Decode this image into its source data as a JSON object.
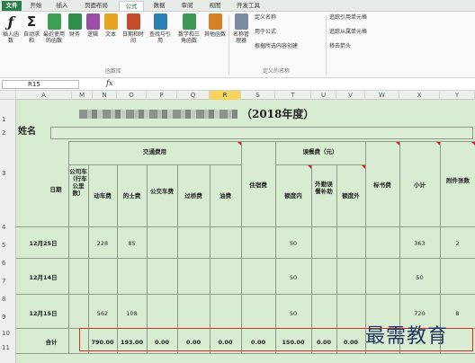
{
  "tabs": [
    "文件",
    "开始",
    "插入",
    "页面布局",
    "公式",
    "数据",
    "审阅",
    "视图",
    "开发工具"
  ],
  "ribbon": {
    "insert_function": "插入函数",
    "autosum": "自动求和",
    "recent": "最近使用的函数",
    "finance": "财务",
    "logical": "逻辑",
    "text": "文本",
    "datetime": "日期和时间",
    "lookup": "查找与引用",
    "math": "数学和三角函数",
    "more": "其他函数",
    "function_library": "函数库",
    "name_manager": "名称管理器",
    "define_name": "定义名称",
    "use_in_formula": "用于公式",
    "create_from_selection": "根据所选内容创建",
    "defined_names": "定义的名称",
    "trace_precedents": "追踪引用单元格",
    "trace_dependents": "追踪从属单元格",
    "remove_arrows": "移去箭头"
  },
  "formula_bar": {
    "namebox": "R15",
    "fx": "fx",
    "value": ""
  },
  "columns": [
    "A",
    "M",
    "N",
    "O",
    "P",
    "Q",
    "R",
    "S",
    "T",
    "U",
    "V",
    "W",
    "X",
    "Y"
  ],
  "rows": [
    "1",
    "2",
    "3",
    "4",
    "5",
    "6",
    "7",
    "8",
    "9",
    "10",
    "11"
  ],
  "sheet": {
    "title_suffix": "（2018年度）",
    "name_label": "姓名",
    "traffic_header": "交通费用",
    "date_header": "日期",
    "lodging_header": "住宿费",
    "allowance_header": "误餐费（元）",
    "standard_header": "标书费",
    "subtotal_header": "小计",
    "attach_header": "附件张数",
    "sub_headers": [
      "公司车（行车公里数）",
      "动车费",
      "的士费",
      "公交车费",
      "过桥费",
      "油费"
    ],
    "allowance_sub": [
      "额度内",
      "外勤误餐补助",
      "额度外"
    ],
    "data_rows": [
      {
        "date": "12月25日",
        "train": "228",
        "taxi": "85",
        "lodging_amount": "50",
        "subtotal": "363",
        "attach": "2"
      },
      {
        "date": "12月14日",
        "lodging_amount": "50",
        "subtotal": "50"
      },
      {
        "date": "12月15日",
        "train": "562",
        "taxi": "108",
        "lodging_amount": "50",
        "subtotal": "720",
        "attach": "8"
      }
    ],
    "total_label": "合计",
    "totals": [
      "790.00",
      "193.00",
      "0.00",
      "0.00",
      "0.00",
      "0.00",
      "150.00",
      "0.00",
      "0.00"
    ]
  },
  "watermark": "最需教育"
}
